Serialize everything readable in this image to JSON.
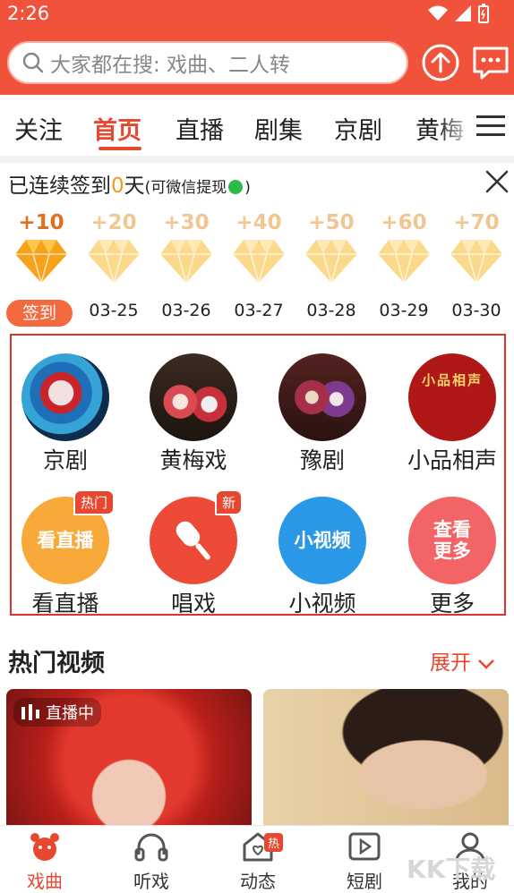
{
  "status": {
    "time": "2:26"
  },
  "search": {
    "placeholder": "大家都在搜: 戏曲、二人转"
  },
  "tabs": [
    {
      "label": "关注"
    },
    {
      "label": "首页"
    },
    {
      "label": "直播"
    },
    {
      "label": "剧集"
    },
    {
      "label": "京剧"
    },
    {
      "label": "黄梅"
    }
  ],
  "checkin": {
    "prefix": "已连续签到",
    "days": "0",
    "unit": "天",
    "note_open": "(可微信提现",
    "note_close": ")",
    "signin_label": "签到",
    "rewards": [
      {
        "points": "+10",
        "date": ""
      },
      {
        "points": "+20",
        "date": "03-25"
      },
      {
        "points": "+30",
        "date": "03-26"
      },
      {
        "points": "+40",
        "date": "03-27"
      },
      {
        "points": "+50",
        "date": "03-28"
      },
      {
        "points": "+60",
        "date": "03-29"
      },
      {
        "points": "+70",
        "date": "03-30"
      }
    ]
  },
  "categories": [
    {
      "label": "京剧"
    },
    {
      "label": "黄梅戏"
    },
    {
      "label": "豫剧"
    },
    {
      "label": "小品相声",
      "circle_text": "小品相声"
    },
    {
      "label": "看直播",
      "circle_text": "看直播",
      "badge": "热门"
    },
    {
      "label": "唱戏",
      "badge": "新"
    },
    {
      "label": "小视频",
      "circle_text": "小视频"
    },
    {
      "label": "更多",
      "circle_text": "查看更多"
    }
  ],
  "hot": {
    "title": "热门视频",
    "expand": "展开",
    "live_tag": "直播中"
  },
  "bottom_nav": [
    {
      "label": "戏曲"
    },
    {
      "label": "听戏"
    },
    {
      "label": "动态",
      "badge": "热"
    },
    {
      "label": "短剧"
    },
    {
      "label": "我的"
    }
  ],
  "watermark": "KK下载",
  "colors": {
    "brand": "#f0523b",
    "accent": "#e8472f",
    "gold": "#f39a1c"
  }
}
